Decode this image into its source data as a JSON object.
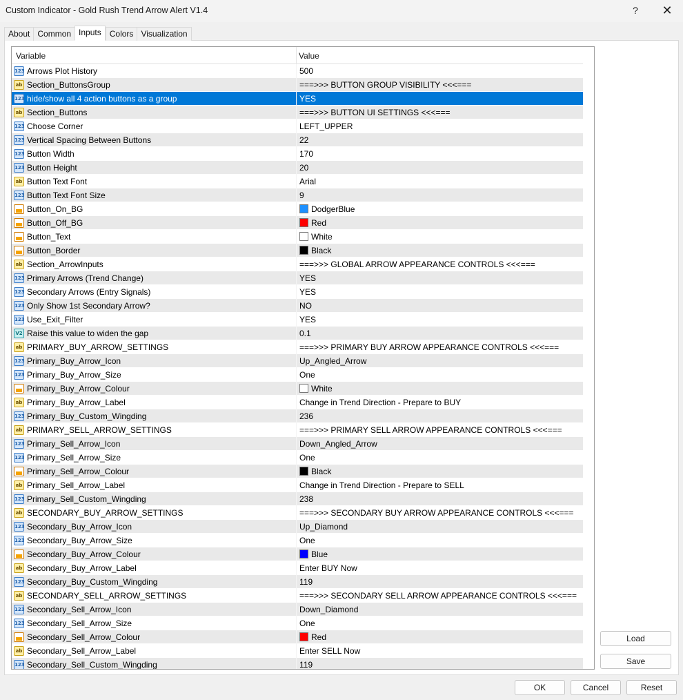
{
  "window": {
    "title": "Custom Indicator - Gold Rush Trend Arrow Alert V1.4",
    "help": "?",
    "close": "✕"
  },
  "tabs": [
    "About",
    "Common",
    "Inputs",
    "Colors",
    "Visualization"
  ],
  "active_tab": "Inputs",
  "table": {
    "headers": {
      "variable": "Variable",
      "value": "Value"
    },
    "rows": [
      {
        "icon": "int",
        "name": "Arrows Plot History",
        "value": "500"
      },
      {
        "icon": "str",
        "name": "Section_ButtonsGroup",
        "value": "===>>> BUTTON GROUP VISIBILITY <<<==="
      },
      {
        "icon": "int",
        "name": "hide/show all 4 action buttons as a group",
        "value": "YES",
        "selected": true
      },
      {
        "icon": "str",
        "name": "Section_Buttons",
        "value": "===>>> BUTTON UI SETTINGS <<<==="
      },
      {
        "icon": "int",
        "name": "Choose Corner",
        "value": "LEFT_UPPER"
      },
      {
        "icon": "int",
        "name": "Vertical Spacing Between Buttons",
        "value": "22"
      },
      {
        "icon": "int",
        "name": "Button Width",
        "value": "170"
      },
      {
        "icon": "int",
        "name": "Button Height",
        "value": "20"
      },
      {
        "icon": "str",
        "name": "Button Text Font",
        "value": "Arial"
      },
      {
        "icon": "int",
        "name": "Button Text Font Size",
        "value": "9"
      },
      {
        "icon": "col",
        "name": "Button_On_BG",
        "value": "DodgerBlue",
        "swatch": "#1e90ff"
      },
      {
        "icon": "col",
        "name": "Button_Off_BG",
        "value": "Red",
        "swatch": "#ff0000"
      },
      {
        "icon": "col",
        "name": "Button_Text",
        "value": "White",
        "swatch": "#ffffff"
      },
      {
        "icon": "col",
        "name": "Button_Border",
        "value": "Black",
        "swatch": "#000000"
      },
      {
        "icon": "str",
        "name": "Section_ArrowInputs",
        "value": "===>>> GLOBAL ARROW APPEARANCE CONTROLS <<<==="
      },
      {
        "icon": "int",
        "name": "Primary Arrows (Trend Change)",
        "value": "YES"
      },
      {
        "icon": "int",
        "name": "Secondary Arrows (Entry Signals)",
        "value": "YES"
      },
      {
        "icon": "int",
        "name": "Only Show 1st Secondary Arrow?",
        "value": "NO"
      },
      {
        "icon": "int",
        "name": "Use_Exit_Filter",
        "value": "YES"
      },
      {
        "icon": "dbl",
        "name": "Raise this value to widen the gap",
        "value": "0.1"
      },
      {
        "icon": "str",
        "name": "PRIMARY_BUY_ARROW_SETTINGS",
        "value": "===>>> PRIMARY BUY ARROW APPEARANCE CONTROLS <<<==="
      },
      {
        "icon": "int",
        "name": "Primary_Buy_Arrow_Icon",
        "value": "Up_Angled_Arrow"
      },
      {
        "icon": "int",
        "name": "Primary_Buy_Arrow_Size",
        "value": "One"
      },
      {
        "icon": "col",
        "name": "Primary_Buy_Arrow_Colour",
        "value": "White",
        "swatch": "#ffffff"
      },
      {
        "icon": "str",
        "name": "Primary_Buy_Arrow_Label",
        "value": "Change in Trend Direction - Prepare to BUY"
      },
      {
        "icon": "int",
        "name": "Primary_Buy_Custom_Wingding",
        "value": "236"
      },
      {
        "icon": "str",
        "name": "PRIMARY_SELL_ARROW_SETTINGS",
        "value": "===>>> PRIMARY SELL ARROW APPEARANCE CONTROLS <<<==="
      },
      {
        "icon": "int",
        "name": "Primary_Sell_Arrow_Icon",
        "value": "Down_Angled_Arrow"
      },
      {
        "icon": "int",
        "name": "Primary_Sell_Arrow_Size",
        "value": "One"
      },
      {
        "icon": "col",
        "name": "Primary_Sell_Arrow_Colour",
        "value": "Black",
        "swatch": "#000000"
      },
      {
        "icon": "str",
        "name": "Primary_Sell_Arrow_Label",
        "value": "Change in Trend Direction - Prepare to SELL"
      },
      {
        "icon": "int",
        "name": "Primary_Sell_Custom_Wingding",
        "value": "238"
      },
      {
        "icon": "str",
        "name": "SECONDARY_BUY_ARROW_SETTINGS",
        "value": "===>>> SECONDARY BUY ARROW APPEARANCE CONTROLS <<<==="
      },
      {
        "icon": "int",
        "name": "Secondary_Buy_Arrow_Icon",
        "value": "Up_Diamond"
      },
      {
        "icon": "int",
        "name": "Secondary_Buy_Arrow_Size",
        "value": "One"
      },
      {
        "icon": "col",
        "name": "Secondary_Buy_Arrow_Colour",
        "value": "Blue",
        "swatch": "#0000ff"
      },
      {
        "icon": "str",
        "name": "Secondary_Buy_Arrow_Label",
        "value": "Enter BUY Now"
      },
      {
        "icon": "int",
        "name": "Secondary_Buy_Custom_Wingding",
        "value": "119"
      },
      {
        "icon": "str",
        "name": "SECONDARY_SELL_ARROW_SETTINGS",
        "value": "===>>> SECONDARY SELL ARROW APPEARANCE CONTROLS <<<==="
      },
      {
        "icon": "int",
        "name": "Secondary_Sell_Arrow_Icon",
        "value": "Down_Diamond"
      },
      {
        "icon": "int",
        "name": "Secondary_Sell_Arrow_Size",
        "value": "One"
      },
      {
        "icon": "col",
        "name": "Secondary_Sell_Arrow_Colour",
        "value": "Red",
        "swatch": "#ff0000"
      },
      {
        "icon": "str",
        "name": "Secondary_Sell_Arrow_Label",
        "value": "Enter SELL Now"
      },
      {
        "icon": "int",
        "name": "Secondary_Sell_Custom_Wingding",
        "value": "119"
      }
    ]
  },
  "icon_glyphs": {
    "int": "123",
    "str": "ab",
    "dbl": "V2",
    "col": ""
  },
  "buttons": {
    "load": "Load",
    "save": "Save",
    "ok": "OK",
    "cancel": "Cancel",
    "reset": "Reset"
  }
}
